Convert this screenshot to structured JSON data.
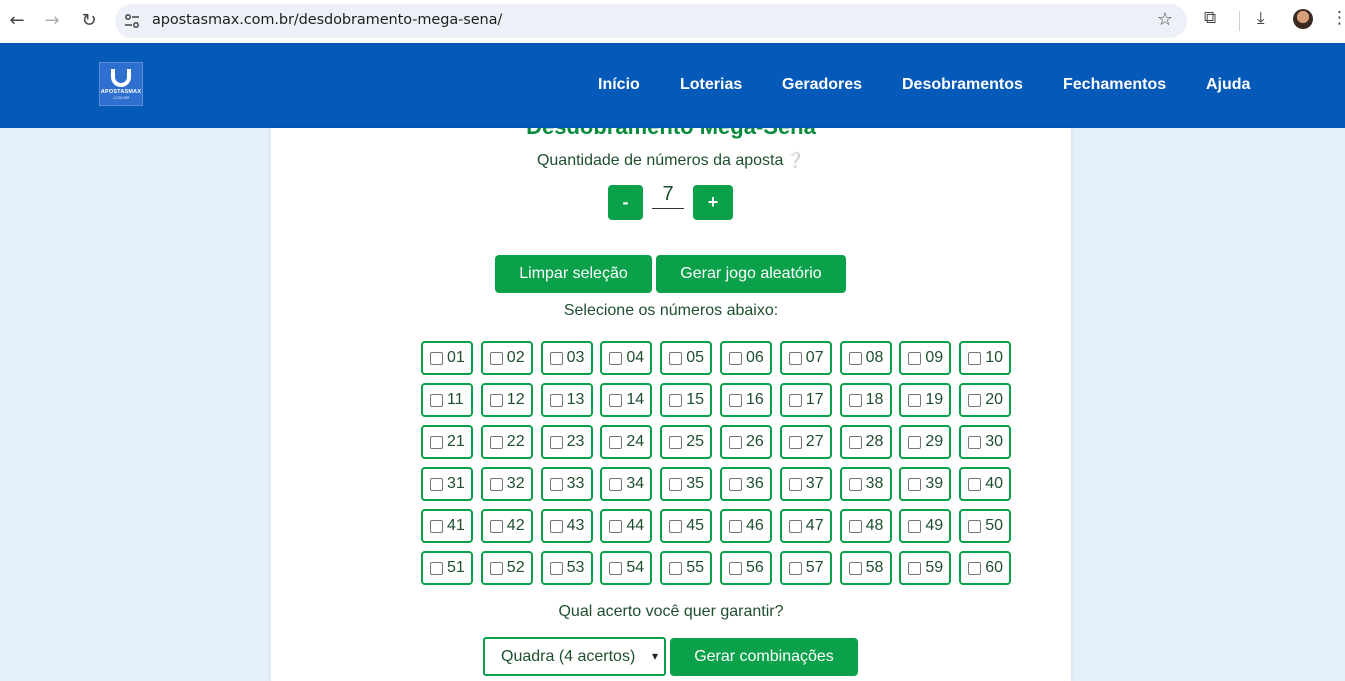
{
  "browser": {
    "url": "apostasmax.com.br/desdobramento-mega-sena/",
    "back_icon": "←",
    "forward_icon": "→",
    "reload_icon": "↻",
    "star_icon": "☆",
    "extensions_icon": "⧉",
    "download_icon": "⤓",
    "menu_icon": "⋮"
  },
  "header": {
    "logo_text": "APOSTASMAX",
    "logo_sub": ".COM.BR",
    "menu": [
      {
        "label": "Início"
      },
      {
        "label": "Loterias"
      },
      {
        "label": "Geradores"
      },
      {
        "label": "Desobramentos"
      },
      {
        "label": "Fechamentos"
      },
      {
        "label": "Ajuda"
      }
    ]
  },
  "main": {
    "title": "Desdobramento Mega-Sena",
    "quantity_label": "Quantidade de números da aposta",
    "help_icon": "❔",
    "quantity_minus": "-",
    "quantity_value": "7",
    "quantity_plus": "+",
    "clear_button": "Limpar seleção",
    "random_button": "Gerar jogo aleatório",
    "select_label": "Selecione os números abaixo:",
    "numbers": [
      "01",
      "02",
      "03",
      "04",
      "05",
      "06",
      "07",
      "08",
      "09",
      "10",
      "11",
      "12",
      "13",
      "14",
      "15",
      "16",
      "17",
      "18",
      "19",
      "20",
      "21",
      "22",
      "23",
      "24",
      "25",
      "26",
      "27",
      "28",
      "29",
      "30",
      "31",
      "32",
      "33",
      "34",
      "35",
      "36",
      "37",
      "38",
      "39",
      "40",
      "41",
      "42",
      "43",
      "44",
      "45",
      "46",
      "47",
      "48",
      "49",
      "50",
      "51",
      "52",
      "53",
      "54",
      "55",
      "56",
      "57",
      "58",
      "59",
      "60"
    ],
    "guarantee_label": "Qual acerto você quer garantir?",
    "guarantee_selected": "Quadra (4 acertos)",
    "generate_button": "Gerar combinações"
  },
  "colors": {
    "header_bg": "#0559b9",
    "accent_green": "#0aa14a",
    "page_bg": "#e6f0fb"
  }
}
